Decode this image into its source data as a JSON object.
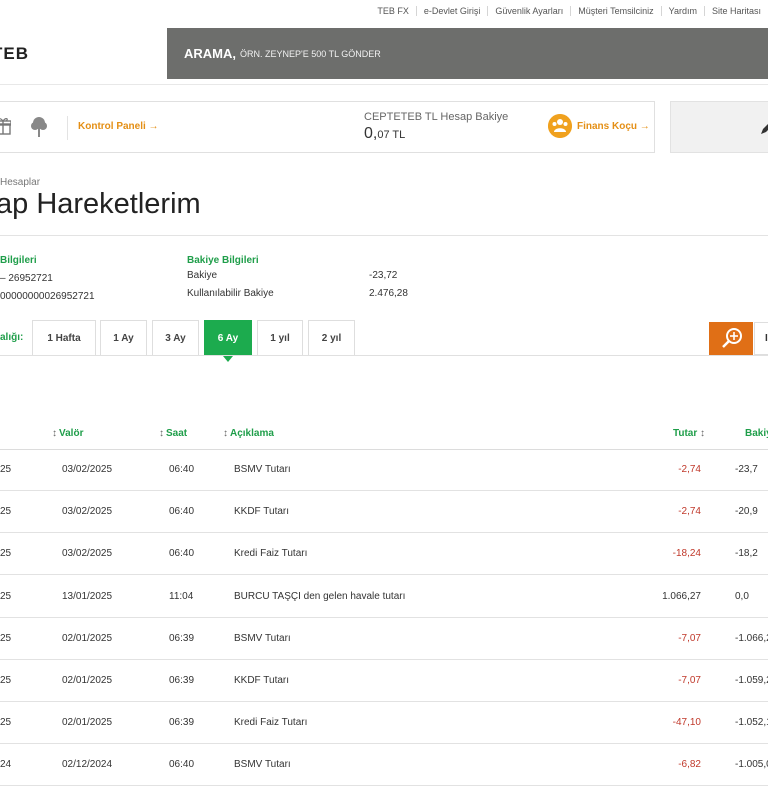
{
  "top_links": [
    "TEB FX",
    "e-Devlet Girişi",
    "Güvenlik Ayarları",
    "Müşteri Temsilciniz",
    "Yardım",
    "Site Haritası"
  ],
  "logo_text": "TEB",
  "search": {
    "bold": "ARAMA,",
    "hint": "ÖRN. ZEYNEP'E 500 TL GÖNDER"
  },
  "quick": {
    "control_panel": "Kontrol Paneli →",
    "balance_title": "CEPTETEB TL Hesap Bakiye",
    "balance_main": "0,",
    "balance_decimal": "07 TL",
    "finance_coach": "Finans Koçu →"
  },
  "breadcrumb": "Hesaplar",
  "page_title": "ap Hareketlerim",
  "account_info": {
    "title": "Bilgileri",
    "line1": "– 26952721",
    "line2": "00000000026952721"
  },
  "balance_info": {
    "title": "Bakiye Bilgileri",
    "balance_label": "Bakiye",
    "balance_value": "-23,72",
    "available_label": "Kullanılabilir Bakiye",
    "available_value": "2.476,28"
  },
  "period": {
    "label": "alığı:",
    "tabs": [
      "1 Hafta",
      "1 Ay",
      "3 Ay",
      "6 Ay",
      "1 yıl",
      "2 yıl"
    ],
    "active": "6 Ay",
    "extra_label": "I"
  },
  "table": {
    "headers": {
      "valor": "Valör",
      "saat": "Saat",
      "aciklama": "Açıklama",
      "tutar": "Tutar",
      "bakiye": "Bakiy"
    },
    "rows": [
      {
        "date": "25",
        "valor": "03/02/2025",
        "saat": "06:40",
        "aciklama": "BSMV Tutarı",
        "tutar": "-2,74",
        "bakiye": "-23,7"
      },
      {
        "date": "25",
        "valor": "03/02/2025",
        "saat": "06:40",
        "aciklama": "KKDF Tutarı",
        "tutar": "-2,74",
        "bakiye": "-20,9"
      },
      {
        "date": "25",
        "valor": "03/02/2025",
        "saat": "06:40",
        "aciklama": "Kredi Faiz Tutarı",
        "tutar": "-18,24",
        "bakiye": "-18,2"
      },
      {
        "date": "25",
        "valor": "13/01/2025",
        "saat": "11:04",
        "aciklama": "BURCU TAŞÇI den gelen havale tutarı",
        "tutar": "1.066,27",
        "bakiye": "0,0"
      },
      {
        "date": "25",
        "valor": "02/01/2025",
        "saat": "06:39",
        "aciklama": "BSMV Tutarı",
        "tutar": "-7,07",
        "bakiye": "-1.066,2"
      },
      {
        "date": "25",
        "valor": "02/01/2025",
        "saat": "06:39",
        "aciklama": "KKDF Tutarı",
        "tutar": "-7,07",
        "bakiye": "-1.059,2"
      },
      {
        "date": "25",
        "valor": "02/01/2025",
        "saat": "06:39",
        "aciklama": "Kredi Faiz Tutarı",
        "tutar": "-47,10",
        "bakiye": "-1.052,1"
      },
      {
        "date": "24",
        "valor": "02/12/2024",
        "saat": "06:40",
        "aciklama": "BSMV Tutarı",
        "tutar": "-6,82",
        "bakiye": "-1.005,0"
      }
    ]
  },
  "colors": {
    "green": "#1cab4e",
    "orange": "#e48f15",
    "search_bg": "#6d6e6c",
    "negative": "#c0392b"
  }
}
